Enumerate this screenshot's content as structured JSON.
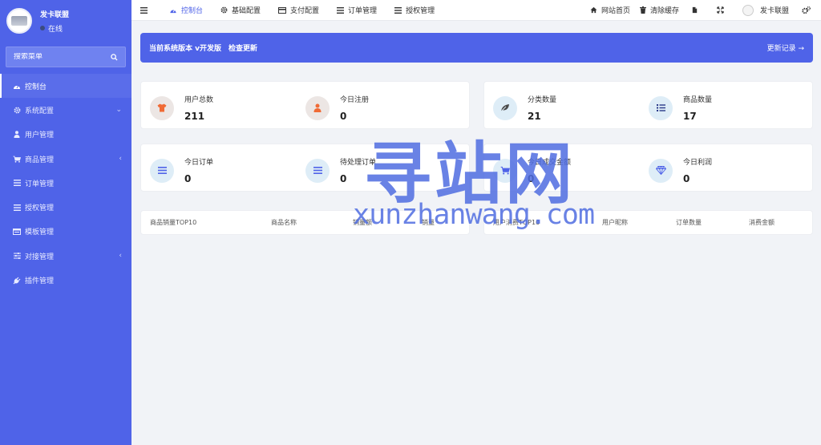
{
  "sidebar": {
    "user_name": "发卡联盟",
    "status": "在线",
    "search_placeholder": "搜索菜单",
    "items": [
      {
        "label": "控制台",
        "icon": "dashboard-icon"
      },
      {
        "label": "系统配置",
        "icon": "gear-icon",
        "arrow": "⌄"
      },
      {
        "label": "用户管理",
        "icon": "user-icon"
      },
      {
        "label": "商品管理",
        "icon": "cart-icon",
        "arrow": "‹"
      },
      {
        "label": "订单管理",
        "icon": "list-icon"
      },
      {
        "label": "授权管理",
        "icon": "list-icon"
      },
      {
        "label": "模板管理",
        "icon": "template-icon"
      },
      {
        "label": "对接管理",
        "icon": "sliders-icon",
        "arrow": "‹"
      },
      {
        "label": "插件管理",
        "icon": "plug-icon"
      }
    ]
  },
  "topbar": {
    "tabs": [
      {
        "label": "控制台",
        "icon": "dashboard-icon"
      },
      {
        "label": "基础配置",
        "icon": "gear-icon"
      },
      {
        "label": "支付配置",
        "icon": "card-icon"
      },
      {
        "label": "订单管理",
        "icon": "list-icon"
      },
      {
        "label": "授权管理",
        "icon": "list-icon"
      }
    ],
    "home": "网站首页",
    "clear_cache": "清除缓存",
    "user": "发卡联盟"
  },
  "notice": {
    "version_text": "当前系统版本 v开发版",
    "check_update": "检查更新",
    "history": "更新记录 →"
  },
  "stats": {
    "users_total": {
      "label": "用户总数",
      "value": "211",
      "icon": "shirt-icon"
    },
    "today_register": {
      "label": "今日注册",
      "value": "0",
      "icon": "person-icon"
    },
    "category_count": {
      "label": "分类数量",
      "value": "21",
      "icon": "leaf-icon"
    },
    "product_count": {
      "label": "商品数量",
      "value": "17",
      "icon": "list-icon"
    },
    "today_orders": {
      "label": "今日订单",
      "value": "0",
      "icon": "menu-icon"
    },
    "pending_orders": {
      "label": "待处理订单",
      "value": "0",
      "icon": "menu-icon"
    },
    "today_amount": {
      "label": "今日成交金额",
      "value": "0",
      "icon": "cart-icon"
    },
    "today_profit": {
      "label": "今日利润",
      "value": "0",
      "icon": "diamond-icon"
    }
  },
  "tables": {
    "products": {
      "title": "商品销量TOP10",
      "cols": [
        "商品名称",
        "销量额",
        "销量"
      ]
    },
    "users": {
      "title": "用户消费TOP10",
      "cols": [
        "用户昵称",
        "订单数量",
        "消费金额"
      ]
    }
  },
  "watermark": {
    "cn": "寻站网",
    "en": "xunzhanwang.com"
  },
  "colors": {
    "accent": "#4f63e8",
    "orange": "#f06a35"
  }
}
